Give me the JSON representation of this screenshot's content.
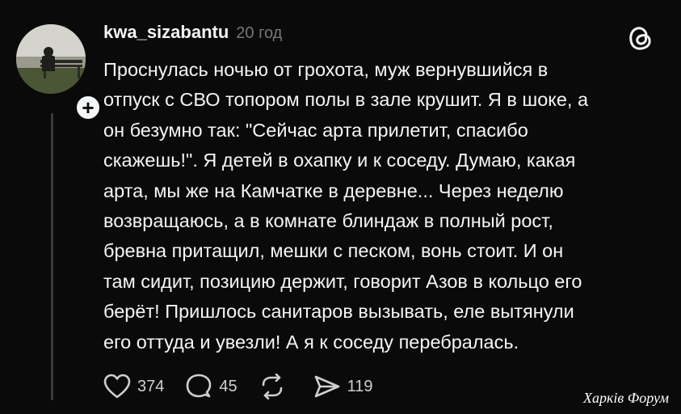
{
  "post": {
    "username": "kwa_sizabantu",
    "timestamp": "20 год",
    "body": "Проснулась ночью от грохота, муж вернувшийся в\nотпуск с СВО топором полы в зале крушит. Я в шоке, а\nон безумно так: \"Сейчас арта прилетит, спасибо\nскажешь!\". Я детей в охапку и к соседу. Думаю, какая\nарта, мы же на Камчатке в деревне... Через неделю\nвозвращаюсь, а в комнате блиндаж в полный рост,\nбревна притащил, мешки с песком, вонь стоит. И он\nтам сидит, позицию держит, говорит Азов в кольцо его\nберёт! Пришлось санитаров вызывать, еле вытянули\nего оттуда и увезли! А я к соседу перебралась.",
    "follow_glyph": "+",
    "actions": {
      "likes": "374",
      "comments": "45",
      "shares": "119"
    }
  },
  "icons": {
    "app_logo": "threads-logo-icon",
    "like": "heart-icon",
    "comment": "speech-bubble-icon",
    "repost": "repost-icon",
    "share": "send-icon"
  },
  "watermark": "Харків Форум",
  "colors": {
    "background": "#0a0a0a",
    "text": "#f3f5f7",
    "muted": "#777777",
    "thread_line": "#3a3a3a"
  }
}
